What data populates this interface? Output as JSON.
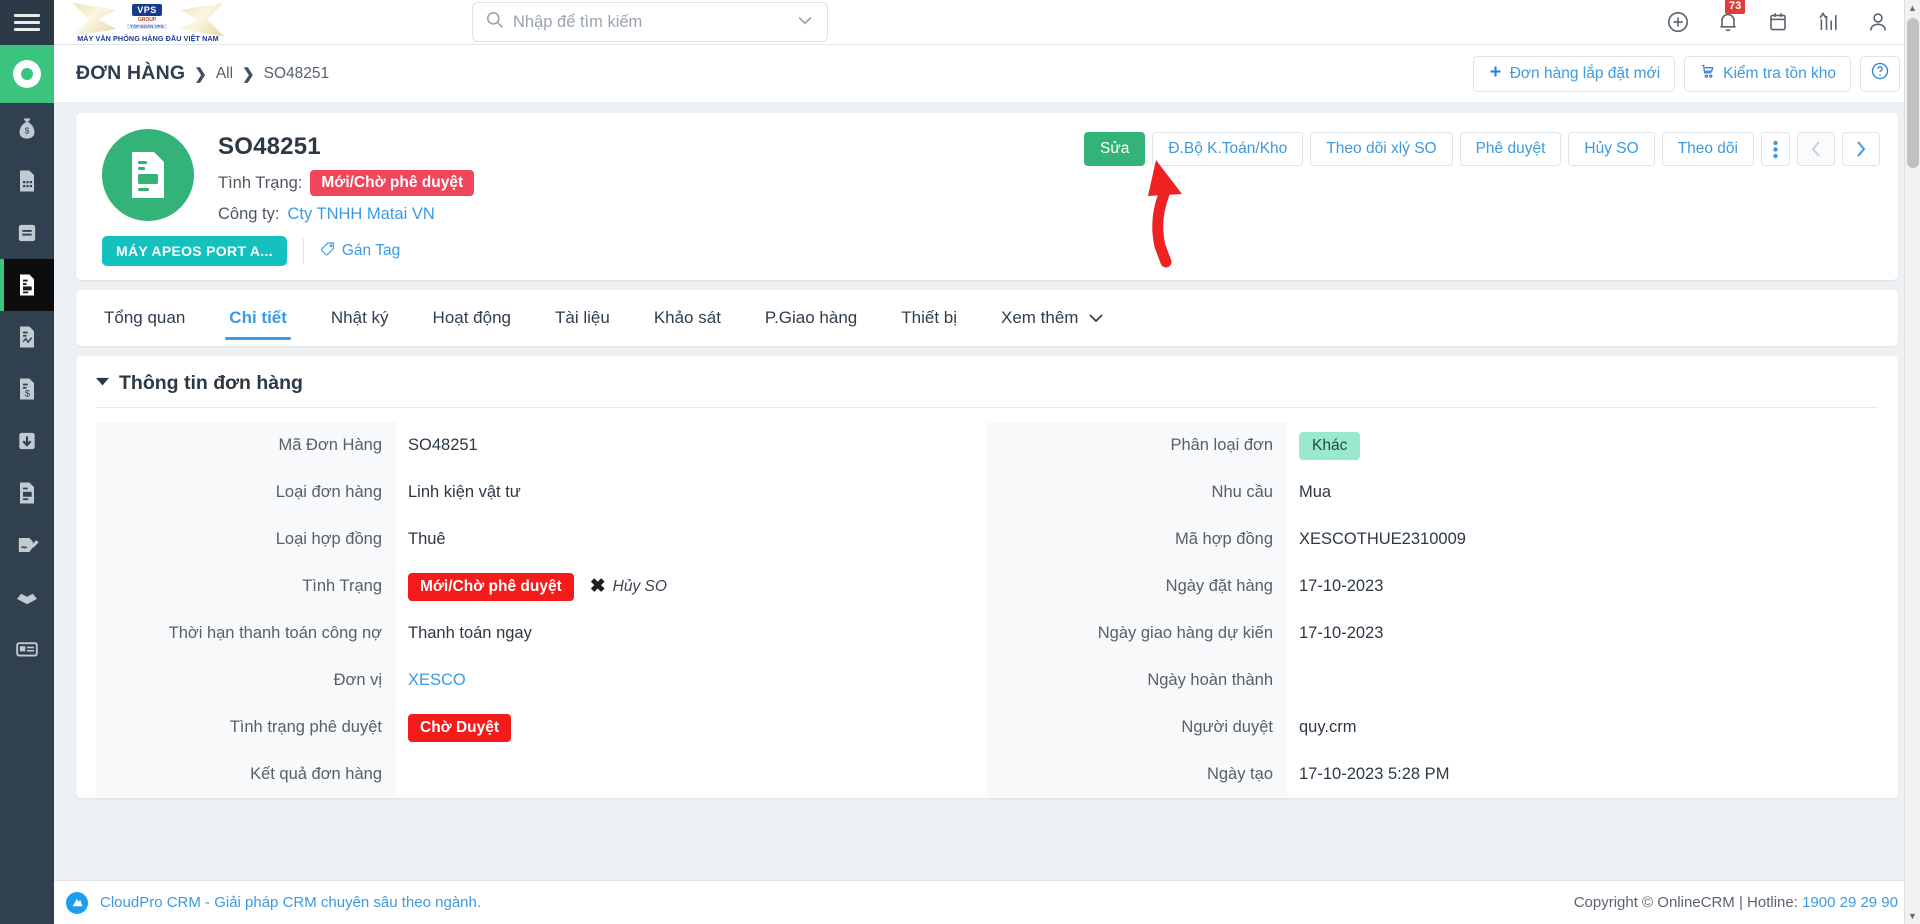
{
  "topbar": {
    "brand": {
      "name": "VPS",
      "sub": "GROUP",
      "sub2": "TẬP ĐOÀN VPS",
      "tagline": "MÁY VĂN PHÒNG HÀNG ĐẦU VIỆT NAM"
    },
    "search": {
      "placeholder": "Nhập để tìm kiếm",
      "value": "",
      "icon": "search-icon"
    },
    "icons": [
      {
        "name": "add-circle-icon",
        "badge": ""
      },
      {
        "name": "bell-icon",
        "badge": "73"
      },
      {
        "name": "calendar-icon",
        "badge": ""
      },
      {
        "name": "chart-icon",
        "badge": ""
      },
      {
        "name": "user-icon",
        "badge": ""
      }
    ]
  },
  "breadcrumb": {
    "module": "ĐƠN HÀNG",
    "view": "All",
    "current": "SO48251",
    "separator": "❯"
  },
  "crumb_actions": [
    {
      "label": "Đơn hàng lắp đặt mới",
      "icon": "plus-icon"
    },
    {
      "label": "Kiểm tra tồn kho",
      "icon": "inventory-cart-icon"
    },
    {
      "label": "",
      "icon": "help-circle-icon"
    }
  ],
  "record": {
    "title": "SO48251",
    "status_label": "Tình Trạng:",
    "status_value": "Mới/Chờ phê duyệt",
    "company_label": "Công ty:",
    "company_value": "Cty TNHH Matai VN",
    "tag": "MÁY APEOS PORT A...",
    "assign_tag": "Gán Tag",
    "avatar_icon": "document-icon"
  },
  "record_actions": [
    {
      "label": "Sửa",
      "style": "primary"
    },
    {
      "label": "Đ.Bộ K.Toán/Kho",
      "style": "default"
    },
    {
      "label": "Theo dõi xlý SO",
      "style": "default"
    },
    {
      "label": "Phê duyệt",
      "style": "default"
    },
    {
      "label": "Hủy SO",
      "style": "default"
    },
    {
      "label": "Theo dõi",
      "style": "default"
    },
    {
      "label": "⋮",
      "style": "more",
      "icon": "more-vertical-icon"
    },
    {
      "label": "‹",
      "style": "disabled",
      "icon": "chevron-left-icon"
    },
    {
      "label": "›",
      "style": "default",
      "icon": "chevron-right-icon"
    }
  ],
  "tabs": [
    {
      "label": "Tổng quan",
      "active": false
    },
    {
      "label": "Chi tiết",
      "active": true
    },
    {
      "label": "Nhật ký",
      "active": false
    },
    {
      "label": "Hoạt động",
      "active": false
    },
    {
      "label": "Tài liệu",
      "active": false
    },
    {
      "label": "Khảo sát",
      "active": false
    },
    {
      "label": "P.Giao hàng",
      "active": false
    },
    {
      "label": "Thiết bị",
      "active": false
    },
    {
      "label": "Xem thêm",
      "active": false,
      "caret": true
    }
  ],
  "section": {
    "title": "Thông tin đơn hàng",
    "caret_icon": "caret-down-icon"
  },
  "fields_left": [
    {
      "label": "Mã Đơn Hàng",
      "value": "SO48251",
      "kind": "text"
    },
    {
      "label": "Loại đơn hàng",
      "value": "Linh kiện vật tư",
      "kind": "text"
    },
    {
      "label": "Loại hợp đồng",
      "value": "Thuê",
      "kind": "text"
    },
    {
      "label": "Tình Trạng",
      "value": "Mới/Chờ phê duyệt",
      "kind": "chip-red",
      "extra": "Hủy SO",
      "extra_icon": "close-x-icon"
    },
    {
      "label": "Thời hạn thanh toán công nợ",
      "value": "Thanh toán ngay",
      "kind": "text"
    },
    {
      "label": "Đơn vị",
      "value": "XESCO",
      "kind": "link"
    },
    {
      "label": "Tình trạng phê duyệt",
      "value": "Chờ Duyệt",
      "kind": "chip-red"
    },
    {
      "label": "Kết quả đơn hàng",
      "value": "",
      "kind": "text"
    }
  ],
  "fields_right": [
    {
      "label": "Phân loại đơn",
      "value": "Khác",
      "kind": "chip-mint"
    },
    {
      "label": "Nhu cầu",
      "value": "Mua",
      "kind": "text"
    },
    {
      "label": "Mã hợp đồng",
      "value": "XESCOTHUE2310009",
      "kind": "text"
    },
    {
      "label": "Ngày đặt hàng",
      "value": "17-10-2023",
      "kind": "text"
    },
    {
      "label": "Ngày giao hàng dự kiến",
      "value": "17-10-2023",
      "kind": "text"
    },
    {
      "label": "Ngày hoàn thành",
      "value": "",
      "kind": "text"
    },
    {
      "label": "Người duyệt",
      "value": "quy.crm",
      "kind": "text"
    },
    {
      "label": "Ngày tạo",
      "value": "17-10-2023 5:28 PM",
      "kind": "text"
    }
  ],
  "sidebar_rail": [
    {
      "name": "sidebar-item-money-bag",
      "icon": "money-bag-icon",
      "active": false
    },
    {
      "name": "sidebar-item-calculator",
      "icon": "calculator-doc-icon",
      "active": false
    },
    {
      "name": "sidebar-item-book",
      "icon": "book-icon",
      "active": false
    },
    {
      "name": "sidebar-item-orders",
      "icon": "order-doc-icon",
      "active": true
    },
    {
      "name": "sidebar-item-report-doc",
      "icon": "report-doc-icon",
      "active": false
    },
    {
      "name": "sidebar-item-invoice",
      "icon": "invoice-dollar-icon",
      "active": false
    },
    {
      "name": "sidebar-item-download",
      "icon": "download-box-icon",
      "active": false
    },
    {
      "name": "sidebar-item-record",
      "icon": "record-doc-icon",
      "active": false
    },
    {
      "name": "sidebar-item-signature",
      "icon": "signature-doc-icon",
      "active": false
    },
    {
      "name": "sidebar-item-package",
      "icon": "open-box-icon",
      "active": false
    },
    {
      "name": "sidebar-item-card",
      "icon": "id-card-icon",
      "active": false
    }
  ],
  "footer": {
    "left": "CloudPro CRM - Giải pháp CRM chuyên sâu theo ngành.",
    "right_prefix": "Copyright © OnlineCRM | Hotline: ",
    "hotline": "1900 29 29 90"
  },
  "colors": {
    "green": "#34b379",
    "blue_link": "#3b9ae1",
    "red_status": "#f0455c",
    "red_chip": "#f51b1b",
    "teal_tag": "#14c1be",
    "mint_chip": "#9ae9cc",
    "rail_dark": "#31404e",
    "annotation_arrow": "#ee2222"
  }
}
